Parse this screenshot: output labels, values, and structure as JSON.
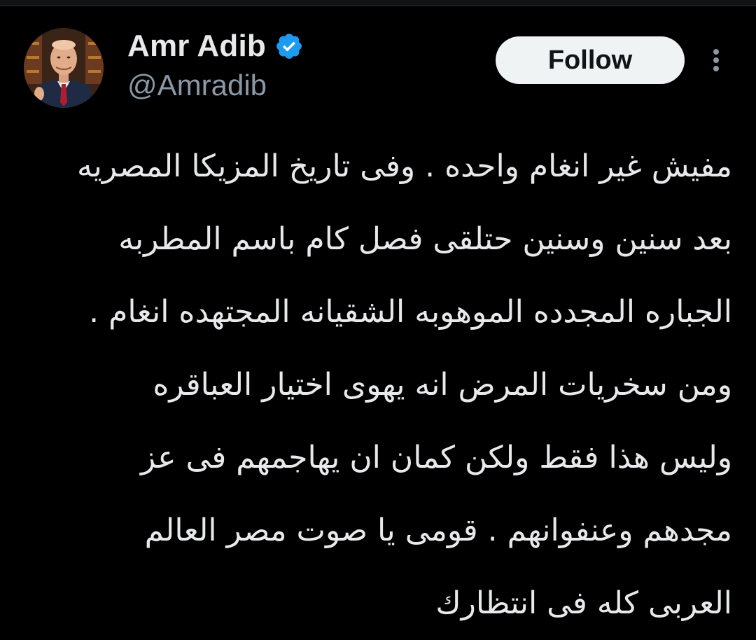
{
  "author": {
    "display_name": "Amr Adib",
    "handle": "@Amradib",
    "verified": true,
    "verified_badge_icon": "verified-badge-icon",
    "verified_color": "#1d9bf0"
  },
  "actions": {
    "follow_label": "Follow",
    "more_icon": "more-vertical-icon"
  },
  "tweet": {
    "lines": [
      "مفيش غير انغام واحده . وفى تاريخ المزيكا المصريه",
      "بعد سنين وسنين حتلقى فصل كام باسم المطربه",
      "الجباره المجدده الموهوبه الشقيانه المجتهده انغام .",
      "ومن سخريات المرض انه يهوى اختيار العباقره",
      "وليس هذا فقط ولكن كمان ان يهاجمهم فى عز",
      "مجدهم وعنفوانهم . قومى يا صوت مصر العالم",
      "العربى كله فى انتظارك"
    ]
  },
  "colors": {
    "background": "#000000",
    "text_primary": "#e7e9ea",
    "text_secondary": "#8b98a5",
    "button_bg": "#eff3f4",
    "button_text": "#0f1419"
  }
}
